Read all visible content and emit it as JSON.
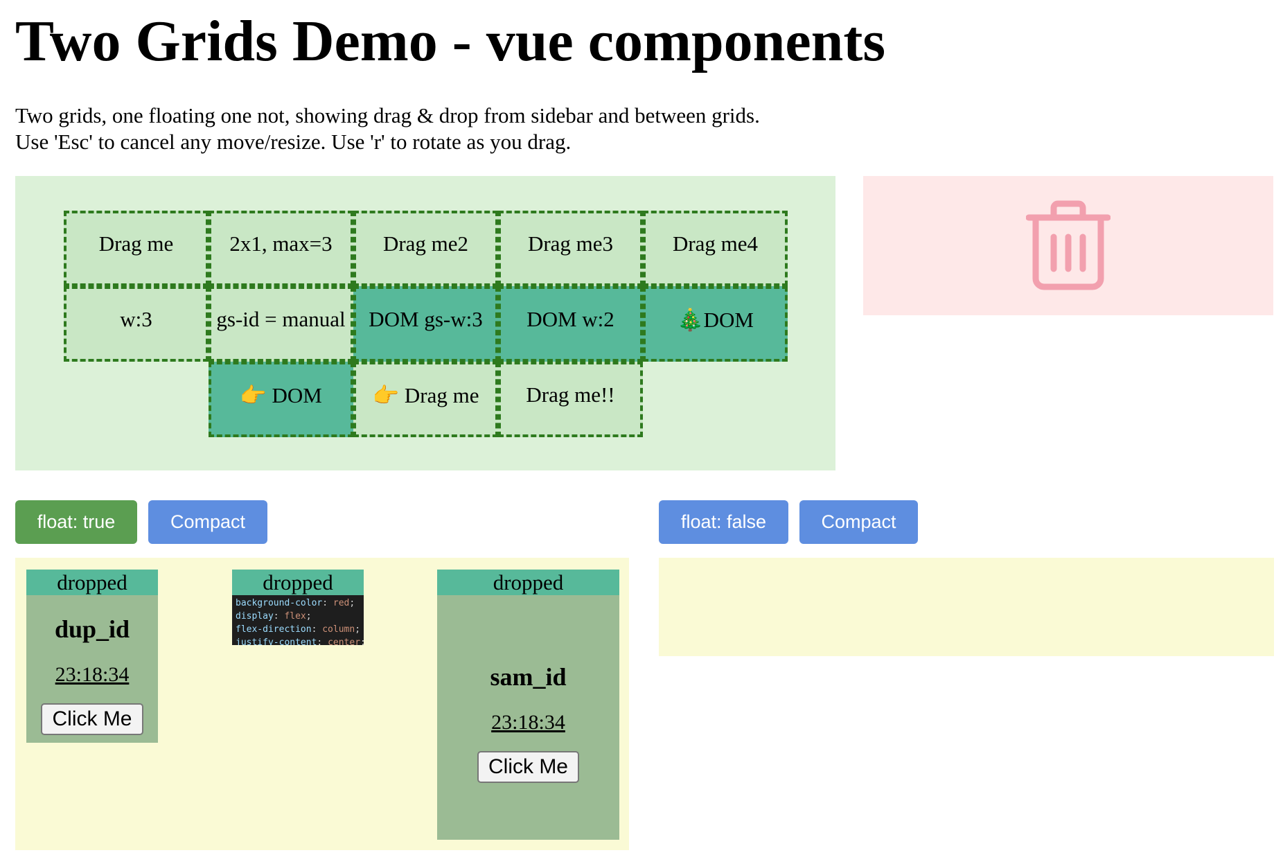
{
  "page": {
    "title": "Two Grids Demo - vue components",
    "description": [
      "Two grids, one floating one not, showing drag & drop from sidebar and between grids.",
      "Use 'Esc' to cancel any move/resize. Use 'r' to rotate as you drag."
    ]
  },
  "sidebar": {
    "items": [
      {
        "label": "Drag me"
      },
      {
        "label": "2x1, max=3"
      },
      {
        "label": "Drag me2"
      },
      {
        "label": "Drag me3"
      },
      {
        "label": "Drag me4"
      },
      {
        "label": "w:3"
      },
      {
        "label": "gs-id = manual"
      },
      {
        "label": "DOM gs-w:3"
      },
      {
        "label": "DOM w:2"
      },
      {
        "label": "🎄DOM"
      },
      {
        "label": "👉 DOM"
      },
      {
        "label": "👉 Drag me"
      },
      {
        "label": "Drag me!!"
      }
    ]
  },
  "trash": {
    "icon": "trash-icon",
    "color": "#f2a0ae"
  },
  "controls": {
    "left": {
      "float_label": "float: true",
      "compact_label": "Compact"
    },
    "right": {
      "float_label": "float: false",
      "compact_label": "Compact"
    }
  },
  "grid1": {
    "items": [
      {
        "header": "dropped",
        "name": "dup_id",
        "time": "23:18:34",
        "button": "Click Me"
      },
      {
        "header": "dropped",
        "code": [
          {
            "k": "background-color",
            "v": "red"
          },
          {
            "k": "display",
            "v": "flex"
          },
          {
            "k": "flex-direction",
            "v": "column"
          },
          {
            "k": "justify-content",
            "v": "center"
          }
        ]
      },
      {
        "header": "dropped",
        "name": "sam_id",
        "time": "23:18:34",
        "button": "Click Me"
      }
    ]
  },
  "colors": {
    "sidebar_bg": "#dcf1d8",
    "trash_bg": "#fee8e8",
    "grid_bg": "#fafad5",
    "dom_item": "#57b99a",
    "float_true_btn": "#5b9e51",
    "blue_btn": "#5e8ee0"
  }
}
